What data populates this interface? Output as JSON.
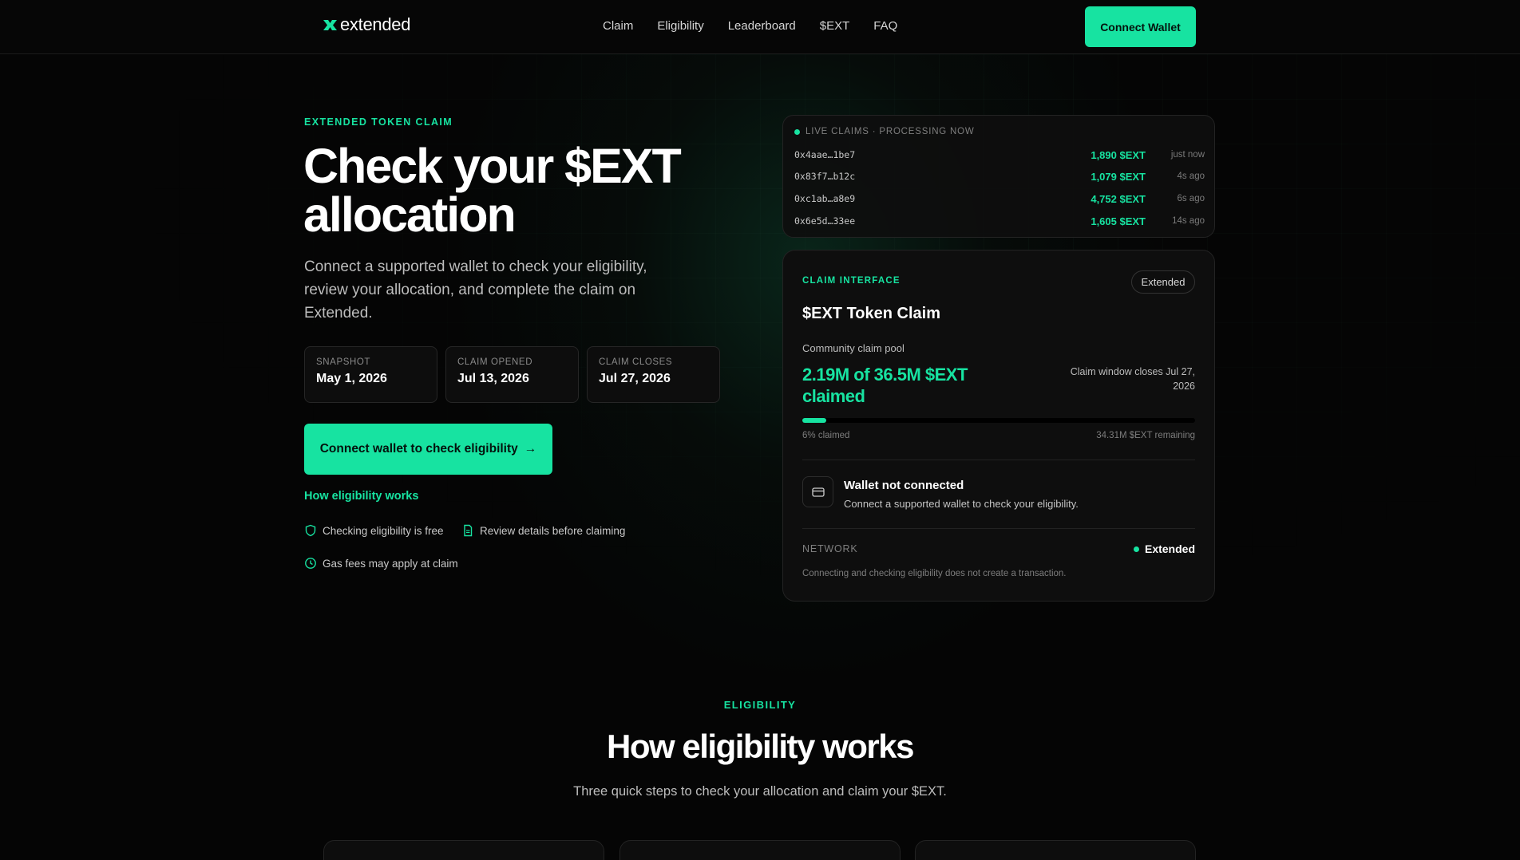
{
  "header": {
    "logo_text": "extended",
    "nav": [
      "Claim",
      "Eligibility",
      "Leaderboard",
      "$EXT",
      "FAQ"
    ],
    "connect_label": "Connect Wallet"
  },
  "hero": {
    "eyebrow": "EXTENDED TOKEN CLAIM",
    "title": "Check your $EXT allocation",
    "subtitle": "Connect a supported wallet to check your eligibility, review your allocation, and complete the claim on Extended.",
    "stats": [
      {
        "label": "SNAPSHOT",
        "value": "May 1, 2026"
      },
      {
        "label": "CLAIM OPENED",
        "value": "Jul 13, 2026"
      },
      {
        "label": "CLAIM CLOSES",
        "value": "Jul 27, 2026"
      }
    ],
    "cta_label": "Connect wallet to check eligibility",
    "cta_arrow": "→",
    "how_link": "How eligibility works",
    "features": [
      "Checking eligibility is free",
      "Review details before claiming",
      "Gas fees may apply at claim"
    ]
  },
  "live_claims": {
    "header": "LIVE CLAIMS · PROCESSING NOW",
    "rows": [
      {
        "address": "0x4aae…1be7",
        "amount": "1,890 $EXT",
        "time": "just now"
      },
      {
        "address": "0x83f7…b12c",
        "amount": "1,079 $EXT",
        "time": "4s ago"
      },
      {
        "address": "0xc1ab…a8e9",
        "amount": "4,752 $EXT",
        "time": "6s ago"
      },
      {
        "address": "0x6e5d…33ee",
        "amount": "1,605 $EXT",
        "time": "14s ago"
      }
    ]
  },
  "claim_card": {
    "eyebrow": "CLAIM INTERFACE",
    "badge": "Extended",
    "title": "$EXT Token Claim",
    "pool_label": "Community claim pool",
    "pool_value": "2.19M of 36.5M $EXT claimed",
    "window_text": "Claim window closes Jul 27, 2026",
    "progress_fraction": 0.06,
    "progress_left": "6% claimed",
    "progress_right": "34.31M $EXT remaining",
    "wallet_title": "Wallet not connected",
    "wallet_sub": "Connect a supported wallet to check your eligibility.",
    "network_label": "NETWORK",
    "network_value": "Extended",
    "disclaimer": "Connecting and checking eligibility does not create a transaction."
  },
  "eligibility": {
    "eyebrow": "ELIGIBILITY",
    "title": "How eligibility works",
    "subtitle": "Three quick steps to check your allocation and claim your $EXT."
  },
  "colors": {
    "accent": "#17e3a1",
    "background": "#050505",
    "card": "#0e0e0e"
  }
}
